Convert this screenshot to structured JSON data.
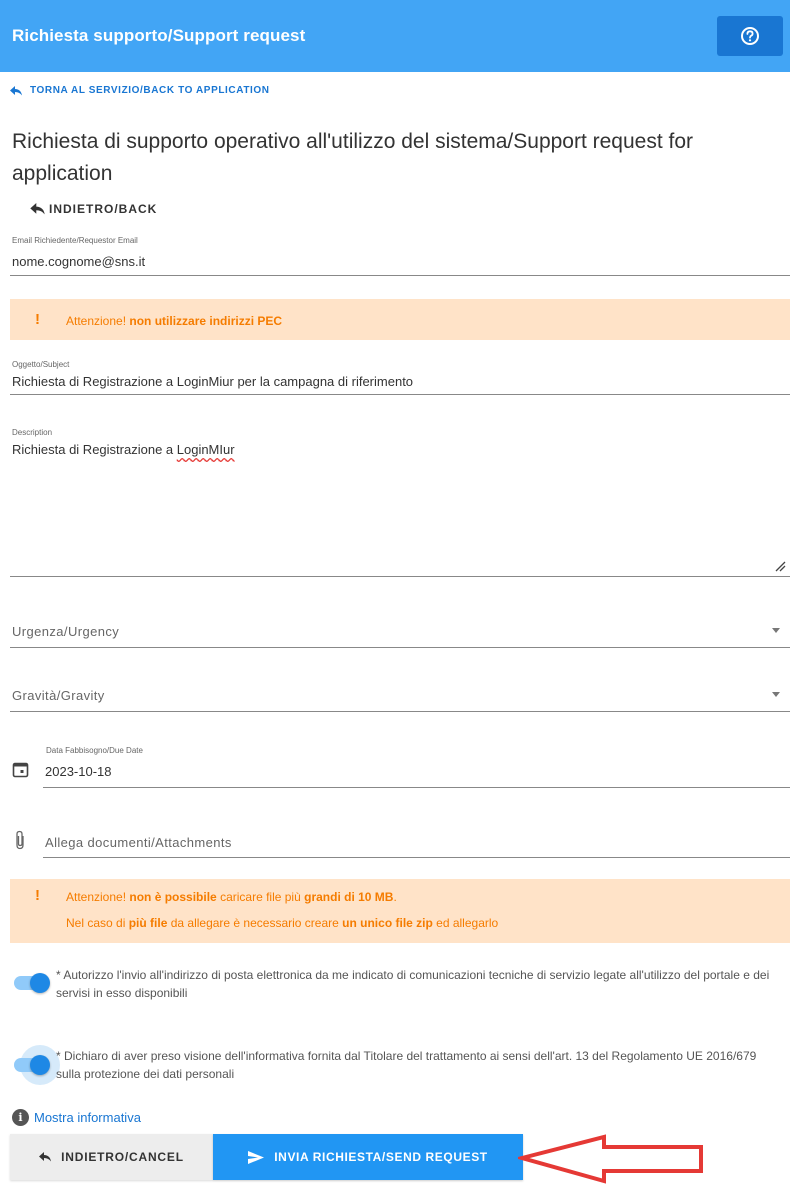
{
  "header": {
    "title": "Richiesta supporto/Support request",
    "help_icon": "help-circle-icon",
    "bg_color": "#42a5f5",
    "button_color": "#1976d2"
  },
  "nav": {
    "back_to_application": "TORNA AL SERVIZIO/BACK TO APPLICATION",
    "back": "INDIETRO/BACK"
  },
  "page_title": "Richiesta di supporto operativo all'utilizzo del sistema/Support request for application",
  "form": {
    "email": {
      "label": "Email Richiedente/Requestor Email",
      "value": "nome.cognome@sns.it"
    },
    "email_warning": {
      "prefix": "Attenzione!",
      "bold": "non utilizzare indirizzi PEC"
    },
    "subject": {
      "label": "Oggetto/Subject",
      "value": "Richiesta di Registrazione a LoginMiur per la campagna di riferimento"
    },
    "description": {
      "label": "Description",
      "value_prefix": "Richiesta di Registrazione a ",
      "value_misspelled": "LoginMIur"
    },
    "urgency": {
      "placeholder": "Urgenza/Urgency"
    },
    "gravity": {
      "placeholder": "Gravità/Gravity"
    },
    "due_date": {
      "label": "Data Fabbisogno/Due Date",
      "value": "2023-10-18"
    },
    "attachments": {
      "placeholder": "Allega documenti/Attachments"
    },
    "attachment_warning": {
      "line1": {
        "p1": "Attenzione!",
        "p2": " non è possibile",
        "p3": " caricare file più ",
        "p4": "grandi di 10 MB",
        "p5": "."
      },
      "line2": {
        "p1": "Nel caso di ",
        "p2": "più file",
        "p3": " da allegare è necessario creare ",
        "p4": "un unico file zip",
        "p5": " ed allegarlo"
      }
    },
    "consent_communications": {
      "checked": true,
      "text": "* Autorizzo l'invio all'indirizzo di posta elettronica da me indicato di comunicazioni tecniche di servizio legate all'utilizzo del portale e dei servisi in esso disponibili"
    },
    "consent_privacy": {
      "checked": true,
      "text": "* Dichiaro di aver preso visione dell'informativa fornita dal Titolare del trattamento ai sensi dell'art. 13 del Regolamento UE 2016/679 sulla protezione dei dati personali"
    },
    "show_info": "Mostra informativa"
  },
  "actions": {
    "cancel": "INDIETRO/CANCEL",
    "send": "INVIA RICHIESTA/SEND REQUEST",
    "send_color": "#2196f3"
  },
  "annotation": {
    "arrow_color": "#e53935"
  }
}
